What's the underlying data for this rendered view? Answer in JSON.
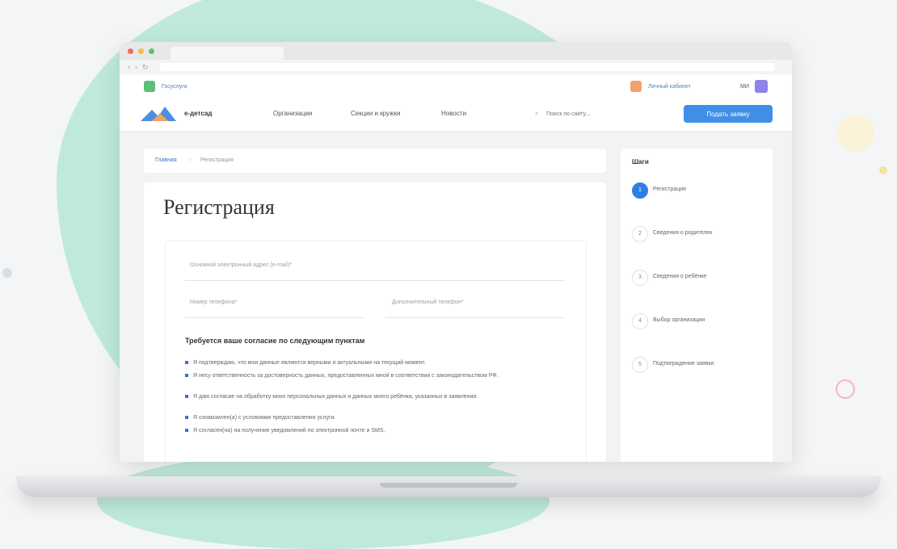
{
  "colors": {
    "background_blob": "#bfeadb",
    "primary": "#3f8fe6",
    "step_active": "#2f7fe2",
    "bullet": "#3f6fd6"
  },
  "top_strip": {
    "left_link": "Госуслуги",
    "right_link": "Личный кабинет",
    "user_initials": "МИ"
  },
  "header": {
    "logo_text": "е-детсад",
    "nav": [
      "Организации",
      "Секции и кружки",
      "Новости"
    ],
    "search_placeholder": "Поиск по сайту...",
    "cta_label": "Подать заявку"
  },
  "breadcrumb": [
    "Главная",
    "Регистрация"
  ],
  "form": {
    "title": "Регистрация",
    "email_label": "Основной электронный адрес (e-mail)*",
    "phone_label": "Номер телефона*",
    "phone_extra_label": "Дополнительный телефон*",
    "consent_title": "Требуется ваше согласие по следующим пунктам",
    "consent_items": [
      "Я подтверждаю, что мои данные являются верными и актуальными на текущий момент.",
      "Я несу ответственность за достоверность данных, предоставленных мной в соответствии с законодательством РФ.",
      "Я даю согласие на обработку моих персональных данных и данных моего ребёнка, указанных в заявлении.",
      "Я ознакомлен(а) с условиями предоставления услуги.",
      "Я согласен(на) на получение уведомлений по электронной почте и SMS."
    ]
  },
  "steps": {
    "title": "Шаги",
    "items": [
      {
        "number": "1",
        "label": "Регистрация",
        "active": true
      },
      {
        "number": "2",
        "label": "Сведения о родителях",
        "active": false
      },
      {
        "number": "3",
        "label": "Сведения о ребёнке",
        "active": false
      },
      {
        "number": "4",
        "label": "Выбор организации",
        "active": false
      },
      {
        "number": "5",
        "label": "Подтверждение заявки",
        "active": false
      }
    ]
  }
}
